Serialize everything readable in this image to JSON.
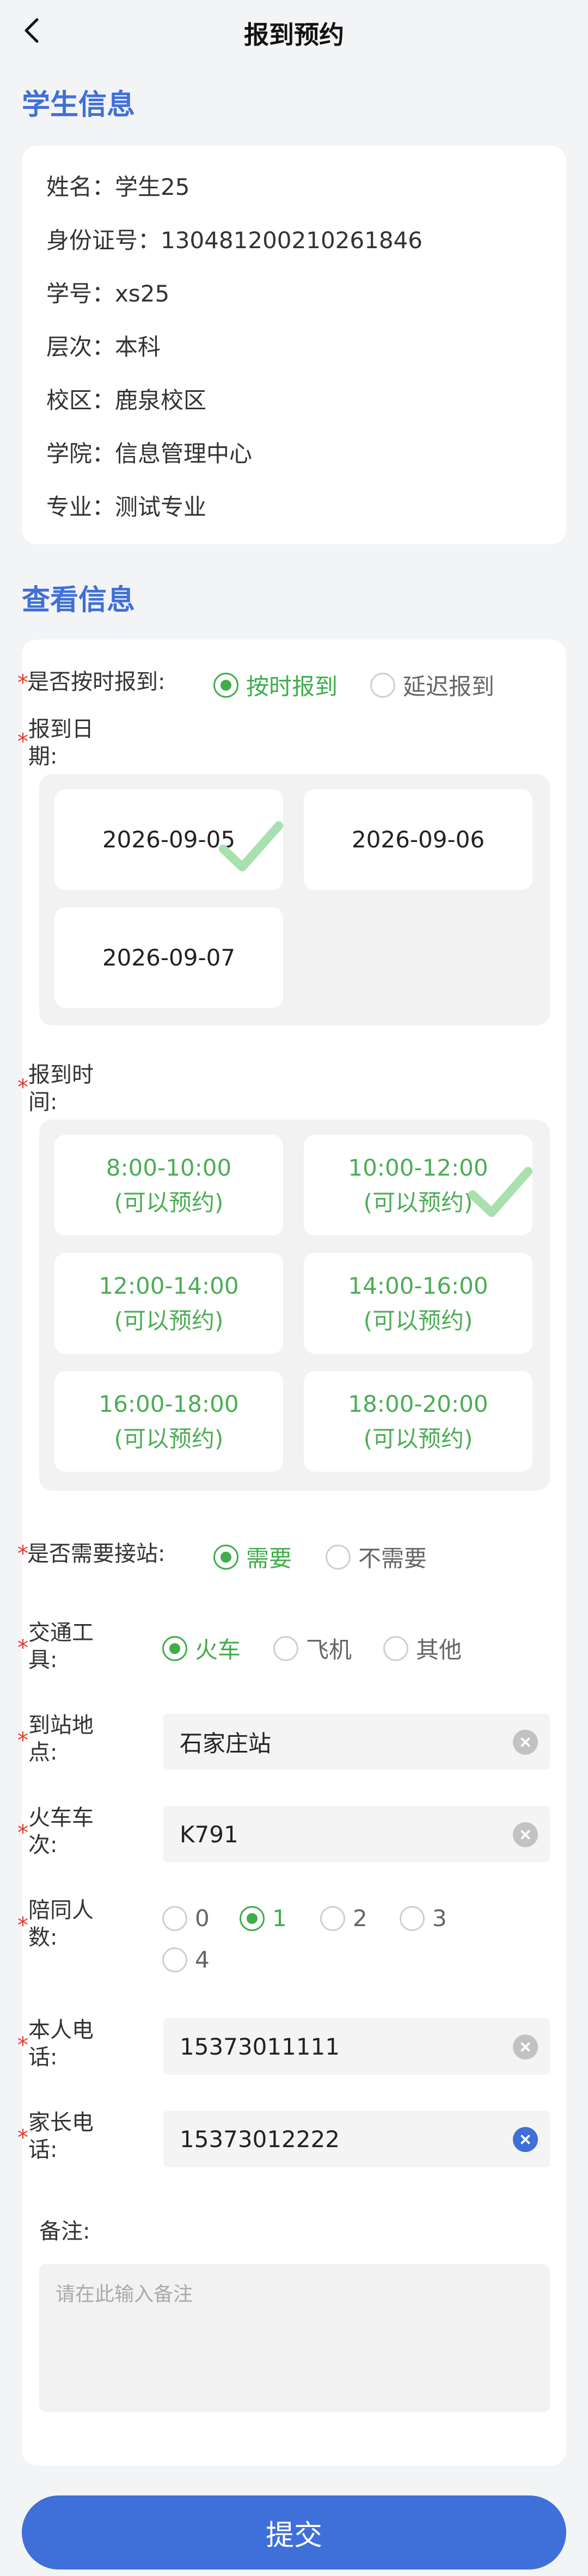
{
  "header": {
    "title": "报到预约",
    "back_icon": "chevron-left-icon"
  },
  "student_section": {
    "title": "学生信息",
    "rows": [
      {
        "label": "姓名：",
        "value": "学生25"
      },
      {
        "label": "身份证号：",
        "value": "130481200210261846"
      },
      {
        "label": "学号：",
        "value": "xs25"
      },
      {
        "label": "层次：",
        "value": "本科"
      },
      {
        "label": "校区：",
        "value": "鹿泉校区"
      },
      {
        "label": "学院：",
        "value": "信息管理中心"
      },
      {
        "label": "专业：",
        "value": "测试专业"
      }
    ]
  },
  "view_section": {
    "title": "查看信息"
  },
  "ontime": {
    "label": "是否按时报到:",
    "options": [
      "按时报到",
      "延迟报到"
    ],
    "selected": "按时报到"
  },
  "date": {
    "label_line1": "报到日",
    "label_line2": "期:",
    "options": [
      "2026-09-05",
      "2026-09-06",
      "2026-09-07"
    ],
    "selected": "2026-09-05"
  },
  "time": {
    "label_line1": "报到时",
    "label_line2": "间:",
    "note": "(可以预约)",
    "slots": [
      "8:00-10:00",
      "10:00-12:00",
      "12:00-14:00",
      "14:00-16:00",
      "16:00-18:00",
      "18:00-20:00"
    ],
    "selected": "10:00-12:00"
  },
  "pickup": {
    "label": "是否需要接站:",
    "options": [
      "需要",
      "不需要"
    ],
    "selected": "需要"
  },
  "transport": {
    "label_line1": "交通工",
    "label_line2": "具:",
    "options": [
      "火车",
      "飞机",
      "其他"
    ],
    "selected": "火车"
  },
  "station": {
    "label_line1": "到站地",
    "label_line2": "点:",
    "value": "石家庄站"
  },
  "train_no": {
    "label_line1": "火车车",
    "label_line2": "次:",
    "value": "K791"
  },
  "companions": {
    "label_line1": "陪同人",
    "label_line2": "数:",
    "options": [
      "0",
      "1",
      "2",
      "3",
      "4"
    ],
    "selected": "1"
  },
  "self_phone": {
    "label_line1": "本人电",
    "label_line2": "话:",
    "value": "15373011111"
  },
  "parent_phone": {
    "label_line1": "家长电",
    "label_line2": "话:",
    "value": "15373012222"
  },
  "remarks": {
    "label": "备注:",
    "placeholder": "请在此输入备注"
  },
  "submit_label": "提交",
  "required_mark": "*",
  "colors": {
    "accent": "#3f6fd8",
    "green": "#3fae49",
    "required": "#e23b2f"
  }
}
